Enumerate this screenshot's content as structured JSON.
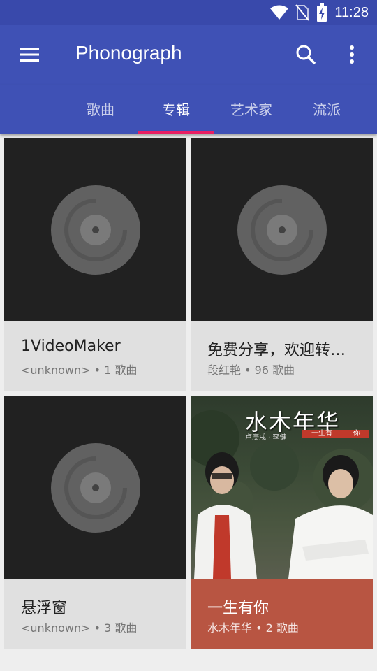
{
  "status": {
    "time": "11:28"
  },
  "toolbar": {
    "title": "Phonograph"
  },
  "tabs": [
    {
      "label": "歌曲",
      "active": false
    },
    {
      "label": "专辑",
      "active": true
    },
    {
      "label": "艺术家",
      "active": false
    },
    {
      "label": "流派",
      "active": false
    }
  ],
  "albums": [
    {
      "title": "1VideoMaker",
      "artist": "<unknown>",
      "count_text": "1 歌曲",
      "subtitle": "<unknown> • 1 歌曲",
      "art": "placeholder-disc"
    },
    {
      "title": "免费分享，欢迎转载",
      "display_title": "免费分享，欢迎转…",
      "artist": "段红艳",
      "count_text": "96 歌曲",
      "subtitle": "段红艳 • 96 歌曲",
      "art": "placeholder-disc"
    },
    {
      "title": "悬浮窗",
      "artist": "<unknown>",
      "count_text": "3 歌曲",
      "subtitle": "<unknown> • 3 歌曲",
      "art": "placeholder-disc"
    },
    {
      "title": "一生有你",
      "artist": "水木年华",
      "count_text": "2 歌曲",
      "subtitle": "水木年华 • 2 歌曲",
      "art": "album-photo",
      "art_text": {
        "title": "水木年华",
        "sub": "卢庚戌 · 李健",
        "banner": "一生有　　　你"
      }
    }
  ],
  "colors": {
    "primary": "#3f51b5",
    "status_bar": "#3949ab",
    "accent": "#e91e63",
    "card_bg": "#e0e0e0",
    "art_placeholder_bg": "#212121",
    "colored_card": "#b85542"
  },
  "icons": {
    "menu": "menu-icon",
    "search": "search-icon",
    "more": "more-vert-icon",
    "wifi": "wifi-icon",
    "no_sim": "no-sim-icon",
    "battery": "battery-charging-icon"
  }
}
